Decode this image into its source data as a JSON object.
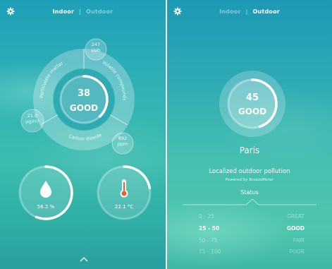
{
  "indoor_screen": {
    "tabs": {
      "indoor": "Indoor",
      "separator": "|",
      "outdoor": "Outdoor",
      "active": "indoor"
    },
    "settings_icon": "gear-icon",
    "score": {
      "value": "38",
      "label": "GOOD",
      "ring_fill": 0.38
    },
    "pollutants": [
      {
        "name": "Particulate matter",
        "value": "21.0",
        "unit": "µg/m³"
      },
      {
        "name": "Volatile compounds",
        "value": "247",
        "unit": "ppb"
      },
      {
        "name": "Carbon dioxide",
        "value": "892",
        "unit": "ppm"
      }
    ],
    "humidity": {
      "icon": "water-drop-icon",
      "value": "56.2 %",
      "ring_fill": 0.56
    },
    "temperature": {
      "icon": "thermometer-icon",
      "value": "22.1 °C",
      "ring_fill": 0.22
    },
    "expand_icon": "chevron-up-icon",
    "colors": {
      "accent_white": "#ffffff",
      "teal_dark": "#1f9fb7",
      "teal_light": "#3cbcae"
    }
  },
  "outdoor_screen": {
    "tabs": {
      "indoor": "Indoor",
      "separator": "|",
      "outdoor": "Outdoor",
      "active": "outdoor"
    },
    "settings_icon": "gear-icon",
    "score": {
      "value": "45",
      "label": "GOOD",
      "ring_fill": 0.45
    },
    "city": "Paris",
    "headline": "Localized outdoor pollution",
    "powered_by": "Powered by BreezoMeter",
    "status_title": "Status",
    "status_table": [
      {
        "range": "0 - 25",
        "level": "GREAT",
        "active": false
      },
      {
        "range": "25 - 50",
        "level": "GOOD",
        "active": true
      },
      {
        "range": "50 - 75",
        "level": "FAIR",
        "active": false
      },
      {
        "range": "75 - 100",
        "level": "POOR",
        "active": false
      }
    ]
  }
}
